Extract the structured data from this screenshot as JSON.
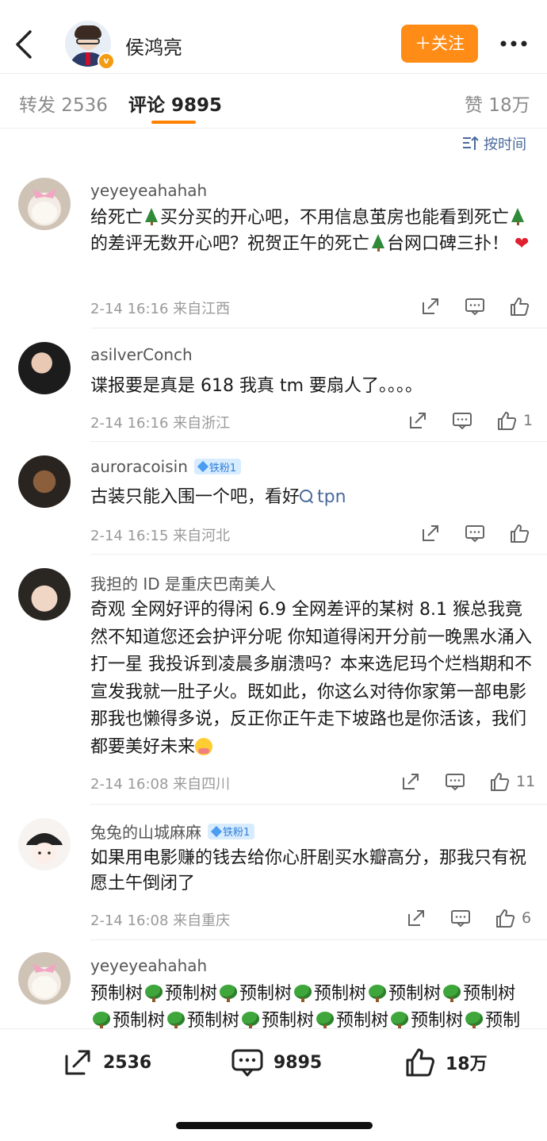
{
  "header": {
    "title": "侯鸿亮",
    "follow_label": "＋关注",
    "verified_badge": "v"
  },
  "tabs": {
    "repost": "转发 2536",
    "comment": "评论 9895",
    "like": "赞 18万"
  },
  "sort_label": "按时间",
  "comments": [
    {
      "name": "yeyeyeahahah",
      "meta": "2-14 16:16  来自江西",
      "likes": ""
    },
    {
      "name": "asilverConch",
      "text": "谍报要是真是 618 我真 tm 要扇人了。。。。",
      "meta": "2-14 16:16  来自浙江",
      "likes": "1"
    },
    {
      "name": "auroracoisin",
      "badge": "铁粉1",
      "text_a": "古装只能入围一个吧，看好",
      "link": "tpn",
      "meta": "2-14 16:15  来自河北",
      "likes": ""
    },
    {
      "name": "我担的 ID 是重庆巴南美人",
      "text": "奇观 全网好评的得闲 6.9 全网差评的某树 8.1 猴总我竟然不知道您还会护评分呢 你知道得闲开分前一晚黑水涌入打一星 我投诉到凌晨多崩溃吗？本来选尼玛个烂档期和不宣发我就一肚子火。既如此，你这么对待你家第一部电影那我也懒得多说，反正你正午走下坡路也是你活该，我们都要美好未来",
      "meta": "2-14 16:08  来自四川",
      "likes": "11"
    },
    {
      "name": "兔兔的山城麻麻",
      "badge": "铁粉1",
      "text": "如果用电影赚的钱去给你心肝剧买水瓣高分，那我只有祝愿土午倒闭了",
      "meta": "2-14 16:08  来自重庆",
      "likes": "6"
    },
    {
      "name": "yeyeyeahahah",
      "word": "预制树"
    }
  ],
  "c1_parts": {
    "p1": "给死亡",
    "p2": "买分买的开心吧，不用信息茧房也能看到死亡",
    "p3": "的差评无数开心吧？祝贺正午的死亡",
    "p4": "台网口碑三扑！",
    "heart": "❤"
  },
  "bottom": {
    "reposts": "2536",
    "comments": "9895",
    "likes": "18万"
  },
  "colors": {
    "accent_orange": "#ff8200",
    "follow_button": "#ff8c16",
    "link_blue": "#4a6a9c",
    "fan_badge_bg": "#d8ecff"
  }
}
